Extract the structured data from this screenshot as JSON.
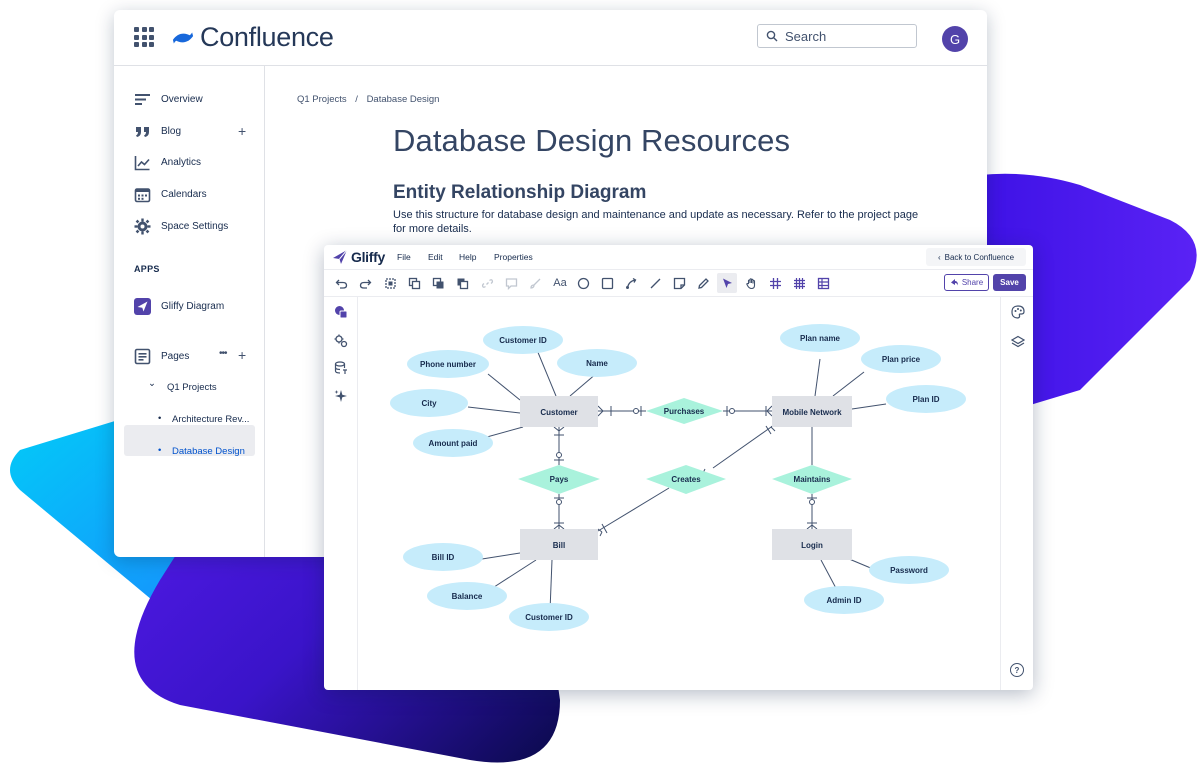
{
  "colors": {
    "confluence_blue": "#1868db",
    "gliffy_purple": "#5243aa",
    "entity_fill": "#dfe1e6",
    "attribute_fill": "#c6ecfb",
    "relationship_fill": "#a9f2dc",
    "bg_cyan": "#00c7f4",
    "bg_violet": "#4c1de9",
    "bg_navy": "#060540"
  },
  "confluence": {
    "logo_text": "Confluence",
    "search_placeholder": "Search",
    "avatar_initial": "G",
    "sidebar": {
      "overview": "Overview",
      "blog": "Blog",
      "analytics": "Analytics",
      "calendars": "Calendars",
      "space_settings": "Space Settings",
      "apps_label": "APPS",
      "gliffy_app": "Gliffy Diagram",
      "pages": "Pages",
      "pages_more": "•••",
      "plus": "+",
      "tree_caret": "⌄",
      "tree_q1": "Q1 Projects",
      "tree_bullet": "•",
      "tree_arch": "Architecture Rev...",
      "tree_db": "Database Design"
    },
    "breadcrumb": {
      "part1": "Q1 Projects",
      "sep": "/",
      "part2": "Database Design"
    },
    "page_title": "Database Design Resources",
    "section_title": "Entity Relationship Diagram",
    "section_desc": "Use this structure for database design and maintenance and update as necessary. Refer to the project page for more details."
  },
  "gliffy": {
    "logo_text": "Gliffy",
    "menu": {
      "file": "File",
      "edit": "Edit",
      "help": "Help",
      "properties": "Properties"
    },
    "back_button": "Back to Confluence",
    "back_arrow": "‹",
    "text_tool_label": "Aa",
    "share_button": "Share",
    "share_icon": "share-icon",
    "save_button": "Save",
    "diagram": {
      "entities": [
        "Customer",
        "Mobile Network",
        "Bill",
        "Login"
      ],
      "relationships": [
        "Purchases",
        "Pays",
        "Creates",
        "Maintains"
      ],
      "attributes": {
        "customer": [
          "Customer ID",
          "Name",
          "Phone number",
          "City",
          "Amount paid"
        ],
        "mobile_network": [
          "Plan name",
          "Plan price",
          "Plan ID"
        ],
        "bill": [
          "Bill ID",
          "Balance",
          "Customer ID"
        ],
        "login": [
          "Password",
          "Admin ID"
        ]
      }
    },
    "help_icon_glyph": "?"
  }
}
